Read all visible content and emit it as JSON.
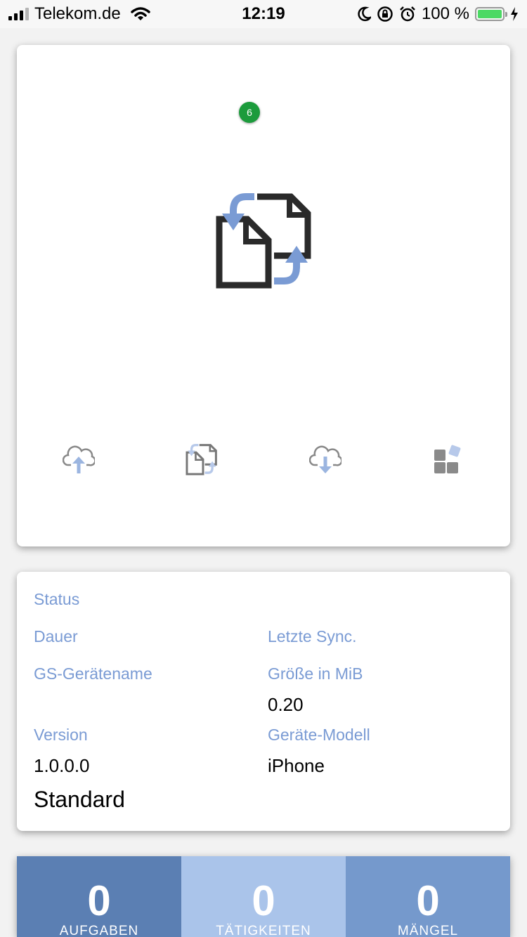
{
  "status_bar": {
    "carrier": "Telekom.de",
    "time": "12:19",
    "battery": "100 %",
    "icons": [
      "signal-icon",
      "wifi-icon",
      "moon-icon",
      "rotation-lock-icon",
      "alarm-icon",
      "battery-icon",
      "charging-bolt-icon"
    ]
  },
  "sync": {
    "badge_count": "6",
    "hero_icon": "sync-files-icon",
    "nav": [
      "cloud-upload-icon",
      "sync-files-icon",
      "cloud-download-icon",
      "apps-icon"
    ]
  },
  "info": {
    "status_label": "Status",
    "duration_label": "Dauer",
    "last_sync_label": "Letzte Sync.",
    "device_name_label": "GS-Gerätename",
    "size_label": "Größe in MiB",
    "size_value": "0.20",
    "version_label": "Version",
    "version_value": "1.0.0.0",
    "model_label": "Geräte-Modell",
    "model_value": "iPhone",
    "profile_value": "Standard"
  },
  "stats": [
    {
      "value": "0",
      "label": "AUFGABEN",
      "color": "#5b7fb3"
    },
    {
      "value": "0",
      "label": "TÄTIGKEITEN",
      "color": "#aac4ea"
    },
    {
      "value": "0",
      "label": "MÄNGEL",
      "color": "#7599cc"
    }
  ],
  "colors": {
    "accent": "#7a9bd4",
    "badge": "#1c9b3c",
    "battery": "#4cd964"
  }
}
